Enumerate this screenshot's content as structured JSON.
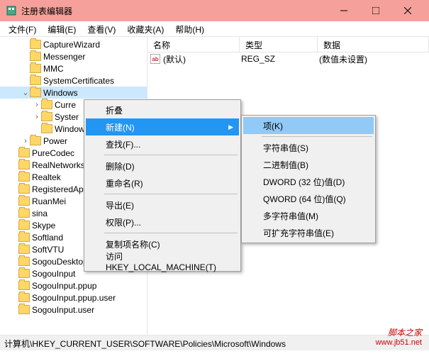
{
  "window": {
    "title": "注册表编辑器"
  },
  "menubar": [
    "文件(F)",
    "编辑(E)",
    "查看(V)",
    "收藏夹(A)",
    "帮助(H)"
  ],
  "tree": [
    {
      "ind": 1,
      "exp": "",
      "label": "CaptureWizard"
    },
    {
      "ind": 1,
      "exp": "",
      "label": "Messenger"
    },
    {
      "ind": 1,
      "exp": "",
      "label": "MMC"
    },
    {
      "ind": 1,
      "exp": "",
      "label": "SystemCertificates"
    },
    {
      "ind": 1,
      "exp": "v",
      "label": "Windows",
      "sel": true
    },
    {
      "ind": 2,
      "exp": ">",
      "label": "Curre"
    },
    {
      "ind": 2,
      "exp": ">",
      "label": "Syster"
    },
    {
      "ind": 2,
      "exp": "",
      "label": "Windows"
    },
    {
      "ind": 1,
      "exp": ">",
      "label": "Power"
    },
    {
      "ind": 0,
      "exp": "",
      "label": "PureCodec"
    },
    {
      "ind": 0,
      "exp": "",
      "label": "RealNetworks"
    },
    {
      "ind": 0,
      "exp": "",
      "label": "Realtek"
    },
    {
      "ind": 0,
      "exp": "",
      "label": "RegisteredAppl"
    },
    {
      "ind": 0,
      "exp": "",
      "label": "RuanMei"
    },
    {
      "ind": 0,
      "exp": "",
      "label": "sina"
    },
    {
      "ind": 0,
      "exp": "",
      "label": "Skype"
    },
    {
      "ind": 0,
      "exp": "",
      "label": "Softland"
    },
    {
      "ind": 0,
      "exp": "",
      "label": "SoftVTU"
    },
    {
      "ind": 0,
      "exp": "",
      "label": "SogouDesktopBar"
    },
    {
      "ind": 0,
      "exp": "",
      "label": "SogouInput"
    },
    {
      "ind": 0,
      "exp": "",
      "label": "SogouInput.ppup"
    },
    {
      "ind": 0,
      "exp": "",
      "label": "SogouInput.ppup.user"
    },
    {
      "ind": 0,
      "exp": "",
      "label": "SogouInput.user"
    }
  ],
  "list": {
    "headers": [
      "名称",
      "类型",
      "数据"
    ],
    "rows": [
      {
        "name": "(默认)",
        "type": "REG_SZ",
        "data": "(数值未设置)"
      }
    ]
  },
  "ctx1": [
    {
      "t": "折叠"
    },
    {
      "t": "新建(N)",
      "hl": true,
      "sub": true
    },
    {
      "t": "查找(F)..."
    },
    {
      "sep": true
    },
    {
      "t": "删除(D)"
    },
    {
      "t": "重命名(R)"
    },
    {
      "sep": true
    },
    {
      "t": "导出(E)"
    },
    {
      "t": "权限(P)..."
    },
    {
      "sep": true
    },
    {
      "t": "复制项名称(C)"
    },
    {
      "t": "访问 HKEY_LOCAL_MACHINE(T)"
    }
  ],
  "ctx2": [
    {
      "t": "项(K)",
      "hov": true
    },
    {
      "sep": true
    },
    {
      "t": "字符串值(S)"
    },
    {
      "t": "二进制值(B)"
    },
    {
      "t": "DWORD (32 位)值(D)"
    },
    {
      "t": "QWORD (64 位)值(Q)"
    },
    {
      "t": "多字符串值(M)"
    },
    {
      "t": "可扩充字符串值(E)"
    }
  ],
  "status": "计算机\\HKEY_CURRENT_USER\\SOFTWARE\\Policies\\Microsoft\\Windows",
  "watermark": {
    "text": "脚本之家",
    "url": "www.jb51.net"
  }
}
